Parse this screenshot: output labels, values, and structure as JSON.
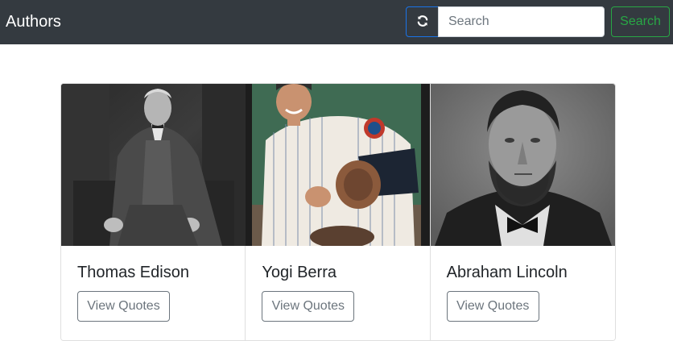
{
  "navbar": {
    "brand": "Authors",
    "refresh_icon": "refresh-icon",
    "search_placeholder": "Search",
    "search_value": "",
    "search_button": "Search",
    "colors": {
      "bg": "#343a40",
      "refresh_border": "#1a73e8",
      "search_green": "#28a745"
    }
  },
  "authors": [
    {
      "name": "Thomas Edison",
      "button": "View Quotes",
      "photo": "thomas-edison-photo"
    },
    {
      "name": "Yogi Berra",
      "button": "View Quotes",
      "photo": "yogi-berra-photo"
    },
    {
      "name": "Abraham Lincoln",
      "button": "View Quotes",
      "photo": "abraham-lincoln-photo"
    }
  ]
}
